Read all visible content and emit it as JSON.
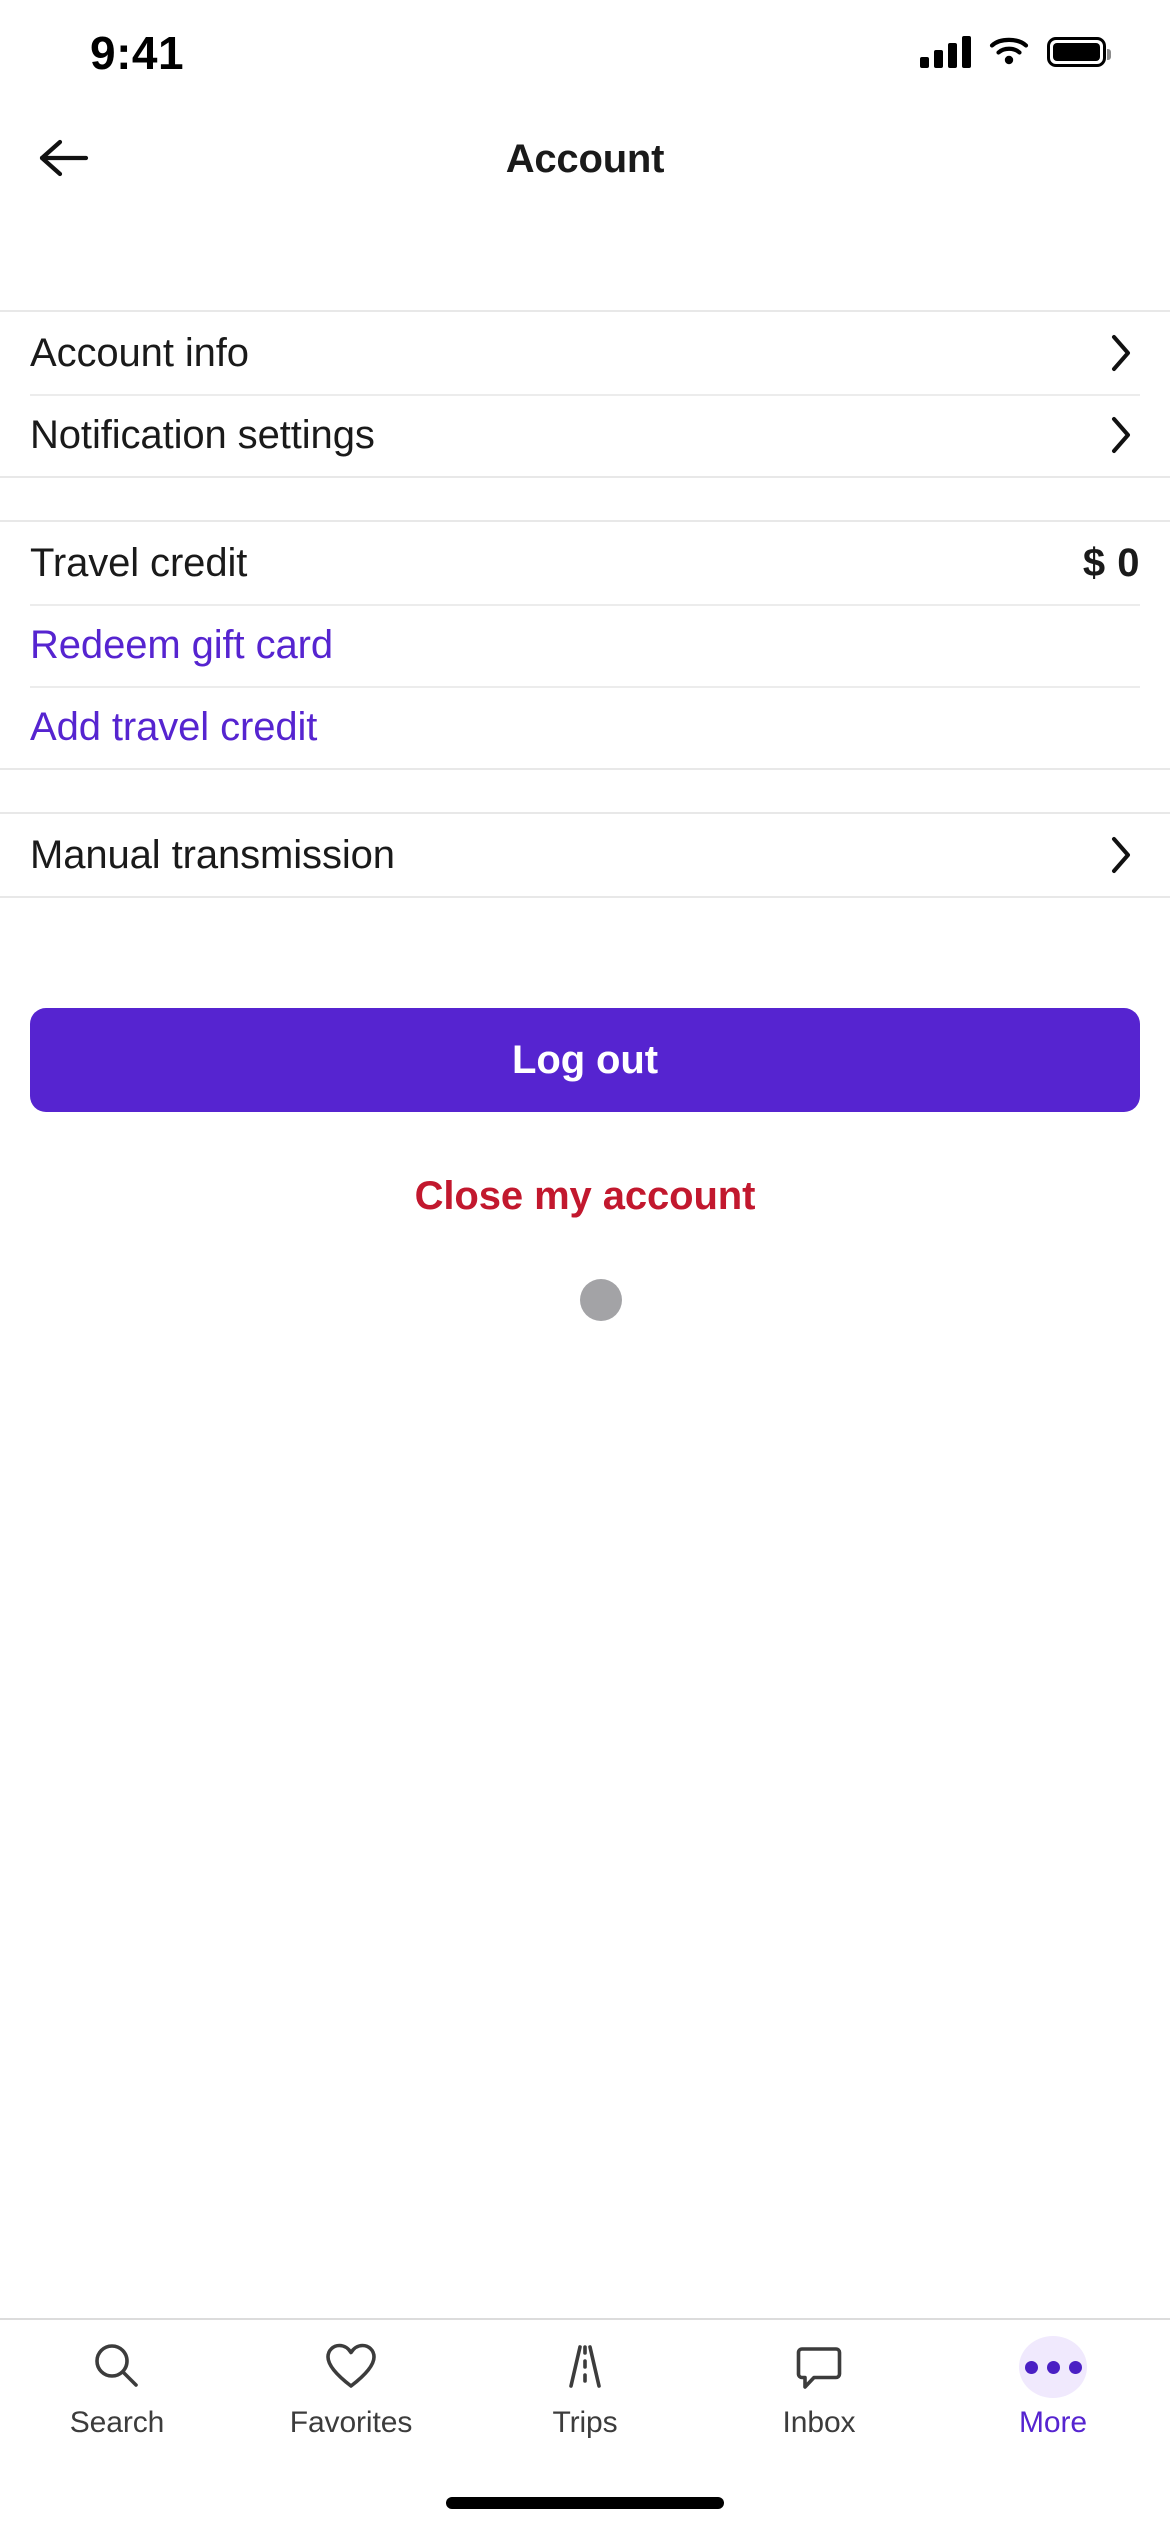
{
  "status_bar": {
    "time": "9:41",
    "signal_icon": "cellular-signal-icon",
    "wifi_icon": "wifi-icon",
    "battery_icon": "battery-full-icon"
  },
  "header": {
    "title": "Account",
    "back_icon": "arrow-left-icon"
  },
  "settings_group": {
    "rows": [
      {
        "label": "Account info",
        "accessory": "chevron-right-icon"
      },
      {
        "label": "Notification settings",
        "accessory": "chevron-right-icon"
      }
    ]
  },
  "credit_group": {
    "rows": [
      {
        "label": "Travel credit",
        "value": "$ 0",
        "type": "value"
      },
      {
        "label": "Redeem gift card",
        "type": "link"
      },
      {
        "label": "Add travel credit",
        "type": "link"
      }
    ]
  },
  "preferences_group": {
    "rows": [
      {
        "label": "Manual transmission",
        "accessory": "chevron-right-icon"
      }
    ]
  },
  "actions": {
    "logout_label": "Log out",
    "close_account_label": "Close my account",
    "spinner": "loading-dot-indicator"
  },
  "tab_bar": {
    "tabs": [
      {
        "label": "Search",
        "icon": "search-icon",
        "active": false
      },
      {
        "label": "Favorites",
        "icon": "heart-icon",
        "active": false
      },
      {
        "label": "Trips",
        "icon": "road-icon",
        "active": false
      },
      {
        "label": "Inbox",
        "icon": "chat-bubble-icon",
        "active": false
      },
      {
        "label": "More",
        "icon": "ellipsis-icon",
        "active": true
      }
    ]
  },
  "colors": {
    "accent_purple": "#5624d0",
    "link_purple": "#5624d0",
    "danger_red": "#c2182e",
    "more_badge_bg": "#f0e9fd",
    "divider": "#e8e8e8",
    "spinner_gray": "#a3a3a6"
  }
}
